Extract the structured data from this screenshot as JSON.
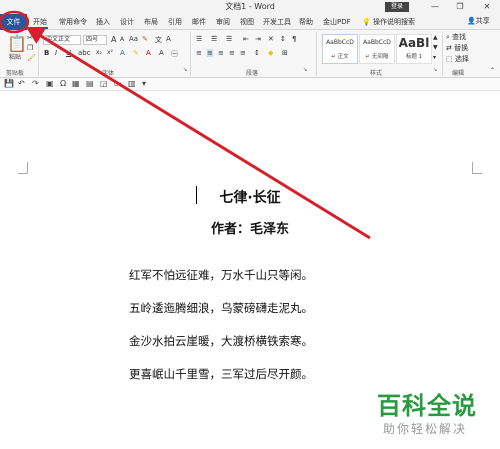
{
  "window": {
    "title": "文档1 - Word",
    "login_label": "登录",
    "minimize_glyph": "—",
    "restore_glyph": "❐",
    "close_glyph": "✕"
  },
  "tabs": {
    "file": "文件",
    "items": [
      "开始",
      "常用命令",
      "插入",
      "设计",
      "布局",
      "引用",
      "邮件",
      "审阅",
      "视图",
      "开发工具",
      "帮助",
      "金山PDF"
    ],
    "tell_me": "操作说明搜索",
    "share": "共享"
  },
  "ribbon": {
    "clipboard": {
      "paste_label": "粘贴",
      "group_label": "剪贴板"
    },
    "font": {
      "font_name": "中文正文",
      "font_size": "四号",
      "grow": "A",
      "shrink": "A",
      "aa": "Aa",
      "bold": "B",
      "italic": "I",
      "underline": "U",
      "group_label": "字体"
    },
    "paragraph": {
      "group_label": "段落"
    },
    "styles": {
      "items": [
        {
          "sample": "AaBbCcD",
          "name": "↵ 正文"
        },
        {
          "sample": "AaBbCcD",
          "name": "↵ 无间隔"
        },
        {
          "sample": "AaBl",
          "name": "标题 1"
        }
      ],
      "group_label": "样式"
    },
    "editing": {
      "find": "查找",
      "replace": "替换",
      "select": "选择",
      "group_label": "编辑"
    }
  },
  "document": {
    "title": "七律·长征",
    "author": "作者：毛泽东",
    "lines": [
      "红军不怕远征难，万水千山只等闲。",
      "五岭逶迤腾细浪，乌蒙磅礴走泥丸。",
      "金沙水拍云崖暖，大渡桥横铁索寒。",
      "更喜岷山千里雪，三军过后尽开颜。"
    ]
  },
  "watermark": {
    "main": "百科全说",
    "sub": "助你轻松解决"
  },
  "annotation": {
    "color": "#d4202a"
  }
}
